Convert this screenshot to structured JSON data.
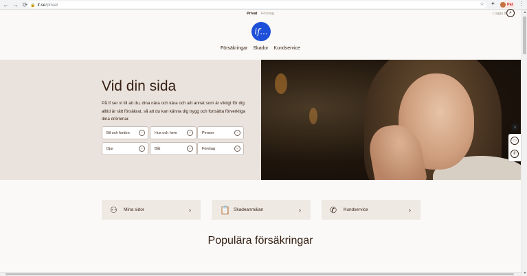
{
  "browser": {
    "back": "←",
    "forward": "→",
    "reload": "⟳",
    "url_host": "if.se",
    "url_path": "/privat",
    "profile_name": "Pat"
  },
  "header": {
    "segments": [
      "Privat",
      "Företag"
    ],
    "login": "Logga in",
    "logo_text": "if...",
    "nav": [
      "Försäkringar",
      "Skador",
      "Kundservice"
    ]
  },
  "hero": {
    "title": "Vid din sida",
    "text": "På If ser vi till att du, dina nära och kära och allt annat som är viktigt för dig alltid är rätt försäkrat, så att du kan känna dig trygg och fortsätta förverkliga dina drömmar.",
    "dropdowns": [
      "Bil och fordon",
      "Hus och hem",
      "Person",
      "Djur",
      "Båt",
      "Företag"
    ]
  },
  "cards": [
    {
      "label": "Mina sidor",
      "icon": "person-icon"
    },
    {
      "label": "Skadeanmälan",
      "icon": "clipboard-icon"
    },
    {
      "label": "Kundservice",
      "icon": "phone-icon"
    }
  ],
  "popular": {
    "title": "Populära försäkringar"
  },
  "colors": {
    "brand_blue": "#1e4fd8",
    "hero_bg": "#eae3dd",
    "text": "#331e11",
    "card_bg": "#efe9e4"
  }
}
